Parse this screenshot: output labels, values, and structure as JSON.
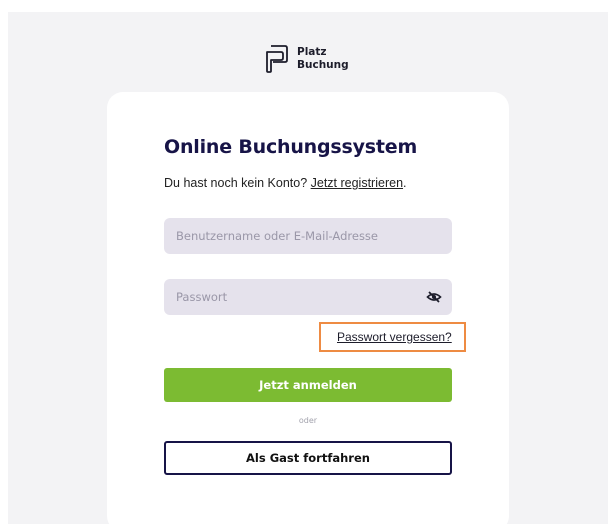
{
  "logo": {
    "line1": "Platz",
    "line2": "Buchung",
    "icon": "platz-buchung-logo-icon"
  },
  "login": {
    "title": "Online Buchungssystem",
    "no_account_text": "Du hast noch kein Konto? ",
    "register_link": "Jetzt registrieren",
    "register_suffix": ".",
    "username_placeholder": "Benutzername oder E-Mail-Adresse",
    "password_placeholder": "Passwort",
    "password_toggle_icon": "eye-slash-icon",
    "forgot_password_link": "Passwort vergessen?",
    "login_button": "Jetzt anmelden",
    "separator": "oder",
    "guest_button": "Als Gast fortfahren"
  },
  "colors": {
    "primary_green": "#7cbb32",
    "title_navy": "#171447",
    "input_bg": "#e5e2ec",
    "highlight_orange": "#ee8b43",
    "page_bg": "#f3f3f5"
  }
}
